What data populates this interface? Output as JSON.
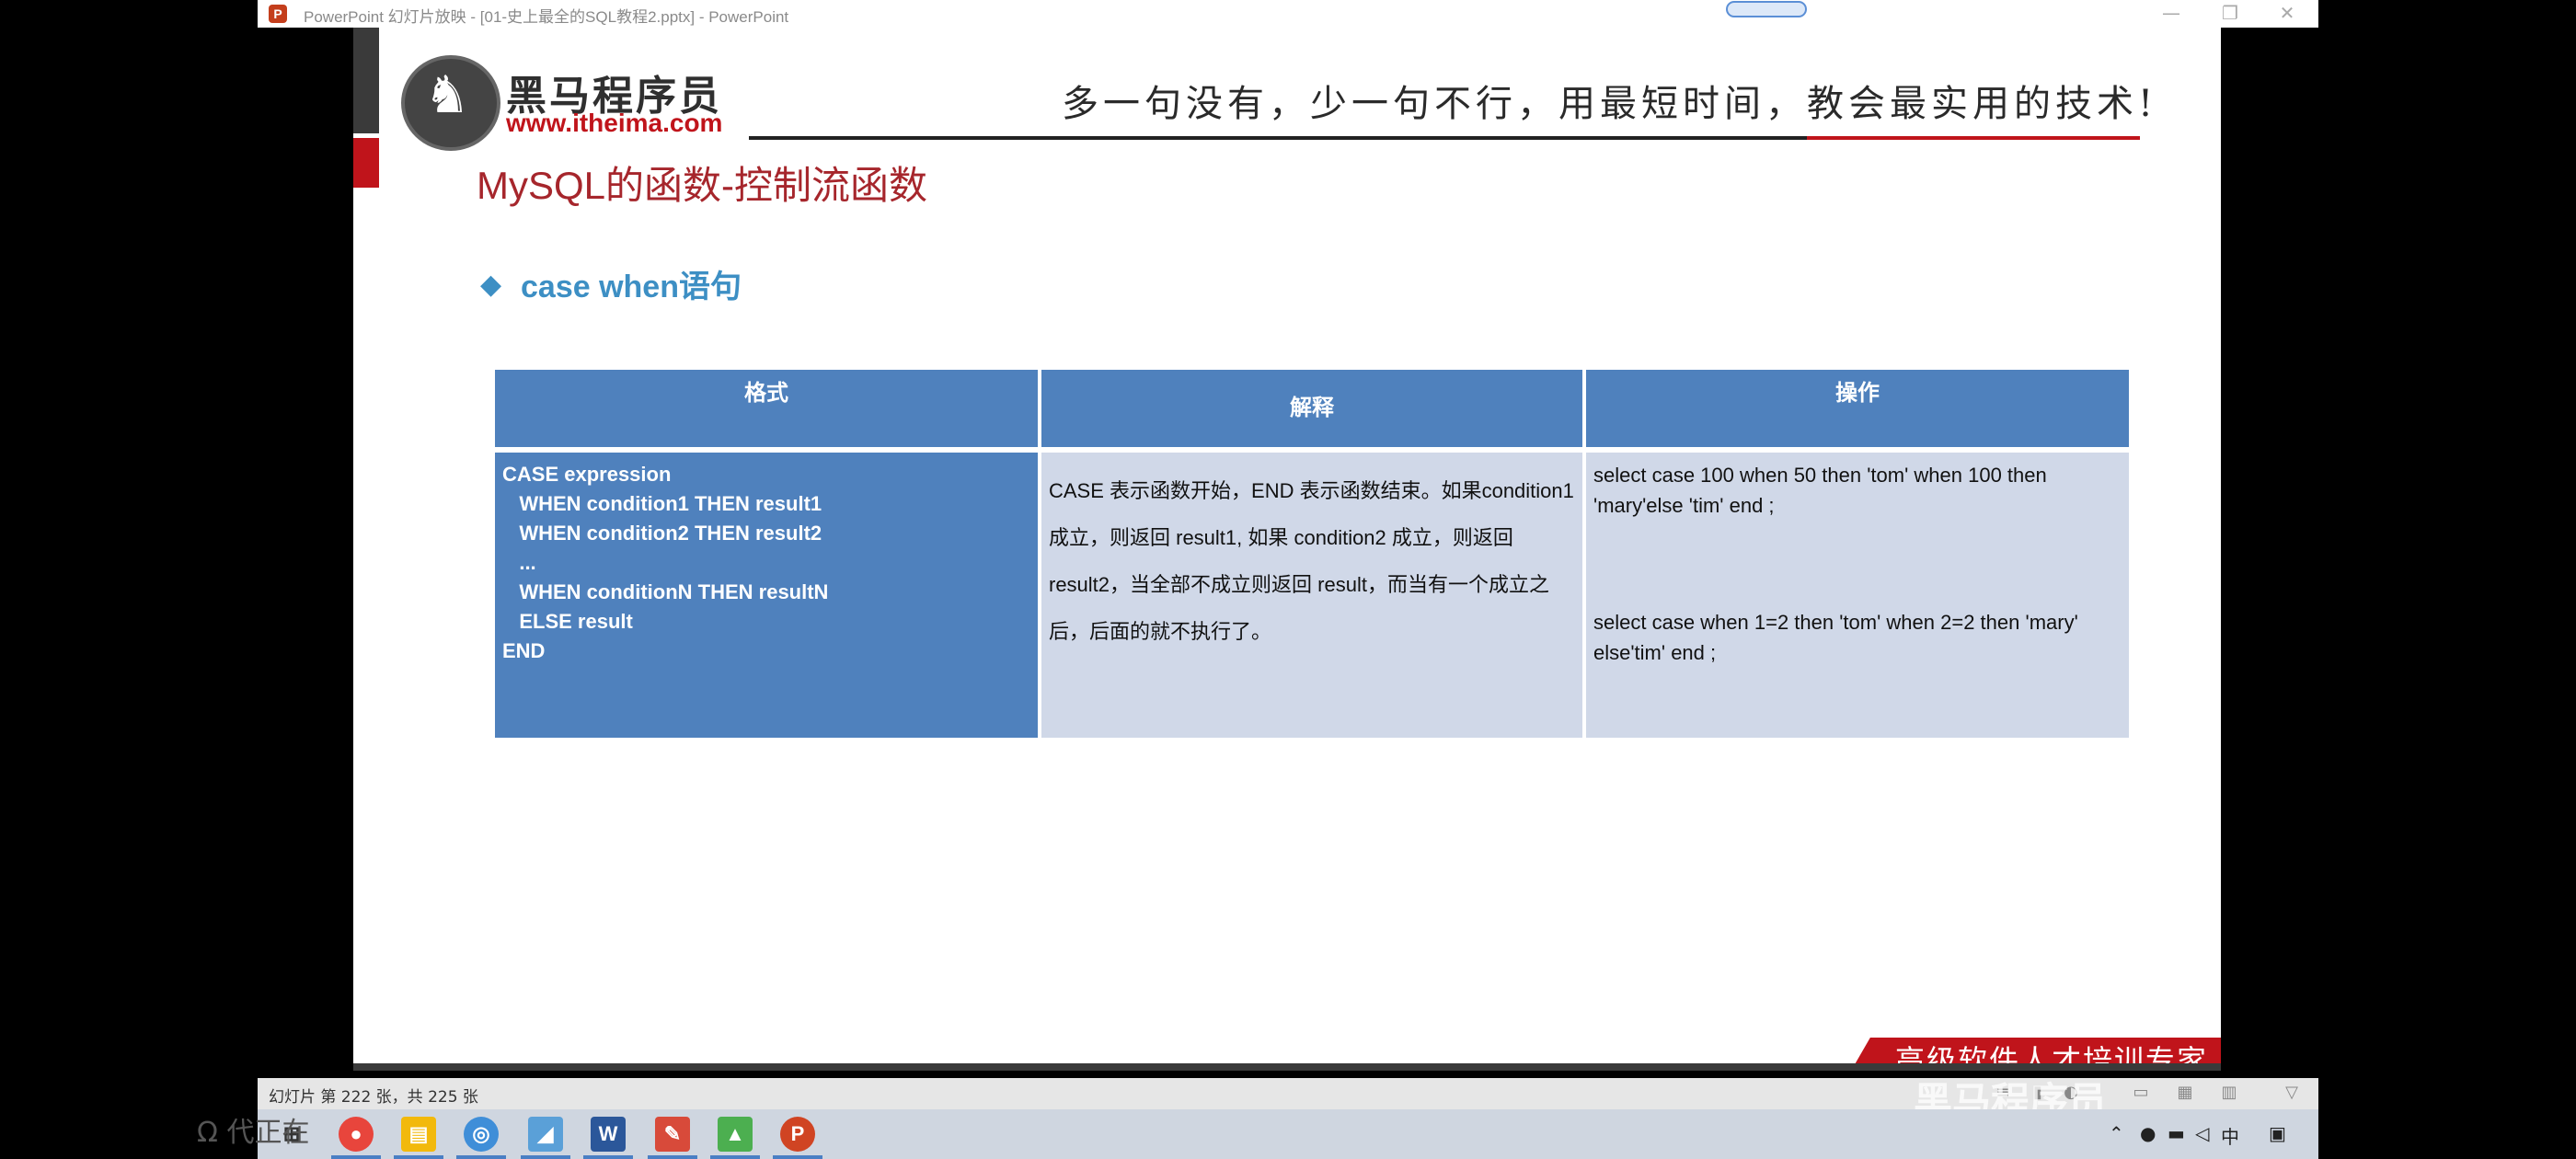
{
  "window": {
    "title": "PowerPoint 幻灯片放映 - [01-史上最全的SQL教程2.pptx] - PowerPoint",
    "app_icon": "P",
    "min_label": "—",
    "restore_label": "❐",
    "close_label": "✕"
  },
  "slide": {
    "logo_cn": "黑马程序员",
    "logo_url": "www.itheima.com",
    "slogan": "多一句没有，少一句不行，用最短时间，教会最实用的技术!",
    "title": "MySQL的函数-控制流函数",
    "bullet": "◆",
    "section_title": "case when语句",
    "table": {
      "headers": [
        "格式",
        "解释",
        "操作"
      ],
      "format_lines": [
        "CASE expression",
        "   WHEN condition1 THEN result1",
        "   WHEN condition2 THEN result2",
        "   ...",
        "   WHEN conditionN THEN resultN",
        "   ELSE result",
        "END"
      ],
      "explanation": "CASE 表示函数开始，END 表示函数结束。如果condition1 成立，则返回 result1, 如果 condition2 成立，则返回 result2，当全部不成立则返回 result，而当有一个成立之后，后面的就不执行了。",
      "op1": "select case 100 when 50 then 'tom' when 100 then 'mary'else 'tim' end ;",
      "op2": "select case when 1=2 then 'tom' when 2=2 then 'mary' else'tim' end ;"
    },
    "ribbon_text": "高级软件人才培训专家"
  },
  "statusbar": {
    "slide_info": "幻灯片 第 222 张，共 225 张"
  },
  "watermark": "黑马程序员",
  "taskbar": {
    "side_text": "Ω 代正在",
    "word_label": "W",
    "ppt_label": "P"
  },
  "colors": {
    "accent_red": "#c0141b",
    "title_red": "#a6262c",
    "section_blue": "#3d8fc4",
    "table_header": "#4f81bd",
    "table_cell": "#d0d8e8"
  }
}
